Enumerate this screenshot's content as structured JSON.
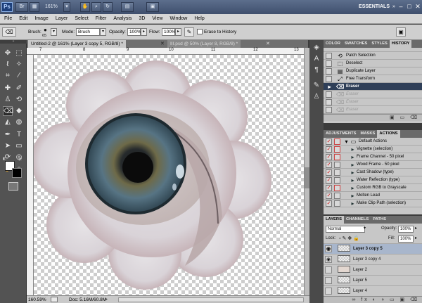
{
  "app": {
    "logo": "Ps",
    "zoom": "161%",
    "workspace": "ESSENTIALS",
    "window_controls": [
      "–",
      "□",
      "✕"
    ]
  },
  "menu": [
    "File",
    "Edit",
    "Image",
    "Layer",
    "Select",
    "Filter",
    "Analysis",
    "3D",
    "View",
    "Window",
    "Help"
  ],
  "options": {
    "brush_label": "Brush:",
    "brush_size": "65",
    "mode_label": "Mode:",
    "mode_value": "Brush",
    "opacity_label": "Opacity:",
    "opacity_value": "100%",
    "flow_label": "Flow:",
    "flow_value": "100%",
    "history_label": "Erase to History"
  },
  "tabs": [
    {
      "label": "Untitled-2 @ 161% (Layer 3 copy 5, RGB/8) *"
    },
    {
      "label": "III.psd @ 50% (Layer 8, RGB/8) *"
    }
  ],
  "ruler": {
    "h": [
      "7",
      "8",
      "9",
      "10",
      "11",
      "12",
      "13"
    ]
  },
  "status": {
    "zoom": "160.59%",
    "doc": "Doc: 5.16M/60.8M"
  },
  "history": {
    "tabs": [
      "COLOR",
      "SWATCHES",
      "STYLES",
      "HISTORY"
    ],
    "items": [
      {
        "label": "Patch Selection",
        "state": "normal"
      },
      {
        "label": "Deselect",
        "state": "normal"
      },
      {
        "label": "Duplicate Layer",
        "state": "normal"
      },
      {
        "label": "Free Transform",
        "state": "normal"
      },
      {
        "label": "Eraser",
        "state": "selected"
      },
      {
        "label": "Eraser",
        "state": "dim"
      },
      {
        "label": "Eraser",
        "state": "dim"
      },
      {
        "label": "Eraser",
        "state": "dim"
      }
    ]
  },
  "actions": {
    "tabs": [
      "ADJUSTMENTS",
      "MASKS",
      "ACTIONS"
    ],
    "items": [
      {
        "label": "Default Actions",
        "folder": true
      },
      {
        "label": "Vignette (selection)"
      },
      {
        "label": "Frame Channel - 50 pixel"
      },
      {
        "label": "Wood Frame - 50 pixel"
      },
      {
        "label": "Cast Shadow (type)"
      },
      {
        "label": "Water Reflection (type)"
      },
      {
        "label": "Custom RGB to Grayscale"
      },
      {
        "label": "Molten Lead"
      },
      {
        "label": "Make Clip Path (selection)"
      }
    ]
  },
  "layers": {
    "tabs": [
      "LAYERS",
      "CHANNELS",
      "PATHS"
    ],
    "blend_mode": "Normal",
    "opacity_label": "Opacity:",
    "opacity_value": "100%",
    "lock_label": "Lock:",
    "fill_label": "Fill:",
    "fill_value": "100%",
    "items": [
      {
        "label": "Layer 3 copy 5",
        "visible": true,
        "selected": true
      },
      {
        "label": "Layer 3 copy 4",
        "visible": true,
        "selected": false
      },
      {
        "label": "Layer 2",
        "visible": false,
        "selected": false
      },
      {
        "label": "Layer 5",
        "visible": false,
        "selected": false
      },
      {
        "label": "Layer 4",
        "visible": false,
        "selected": false
      }
    ],
    "footer_icons": "∞ fx ◐ ◑ ▭ ▣ ⌫"
  }
}
